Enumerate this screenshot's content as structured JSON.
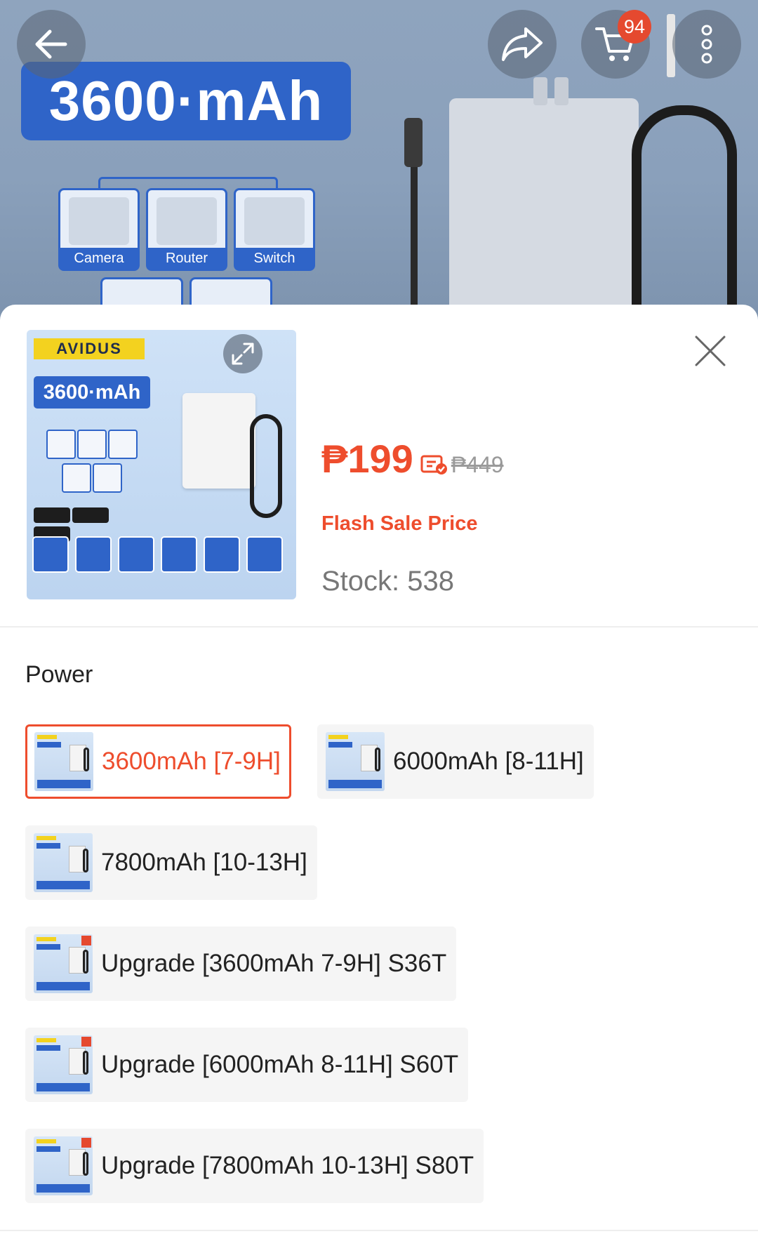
{
  "hero": {
    "capacity_badge": "3600·mAh",
    "devices": [
      "Camera",
      "Router",
      "Switch"
    ],
    "cart_count": "94",
    "icons": {
      "back": "arrow-left-icon",
      "share": "share-arrow-icon",
      "cart": "cart-icon",
      "more": "more-vertical-icon"
    }
  },
  "sheet": {
    "thumbnail": {
      "brand": "AVIDUS",
      "capacity_text": "3600·mAh"
    },
    "price": "₱199",
    "original_price": "₱449",
    "price_label": "Flash Sale Price",
    "stock": "Stock: 538",
    "section_title": "Power",
    "selected_option": "3600mAh [7-9H]",
    "options": [
      {
        "label": "3600mAh [7-9H]",
        "selected": true
      },
      {
        "label": "6000mAh [8-11H]",
        "selected": false
      },
      {
        "label": "7800mAh [10-13H]",
        "selected": false
      },
      {
        "label": "Upgrade [3600mAh 7-9H] S36T",
        "selected": false
      },
      {
        "label": "Upgrade [6000mAh 8-11H] S60T",
        "selected": false
      },
      {
        "label": "Upgrade [7800mAh 10-13H] S80T",
        "selected": false
      }
    ]
  },
  "colors": {
    "accent": "#ee4d2d",
    "brand_blue": "#2f64c8",
    "cart_badge": "#e5492f"
  }
}
